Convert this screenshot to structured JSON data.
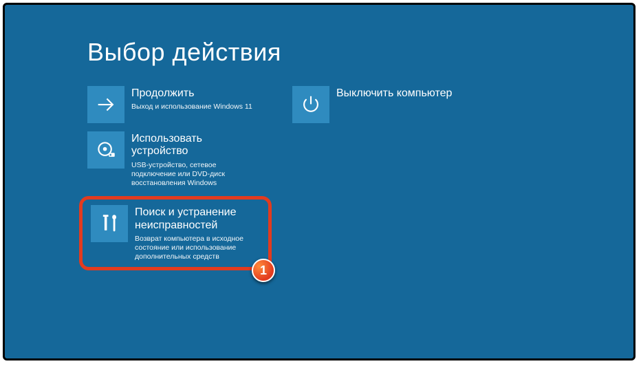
{
  "title": "Выбор действия",
  "tiles": {
    "continue": {
      "title": "Продолжить",
      "desc": "Выход и использование Windows 11"
    },
    "useDevice": {
      "title": "Использовать устройство",
      "desc": "USB-устройство, сетевое подключение или DVD-диск восстановления Windows"
    },
    "troubleshoot": {
      "title": "Поиск и устранение неисправностей",
      "desc": "Возврат компьютера в исходное состояние или использование дополнительных средств"
    },
    "shutdown": {
      "title": "Выключить компьютер"
    }
  },
  "callout": {
    "number": "1"
  },
  "colors": {
    "background": "#15689a",
    "tileIcon": "#2f8bbf",
    "highlight": "#e23b1f"
  }
}
